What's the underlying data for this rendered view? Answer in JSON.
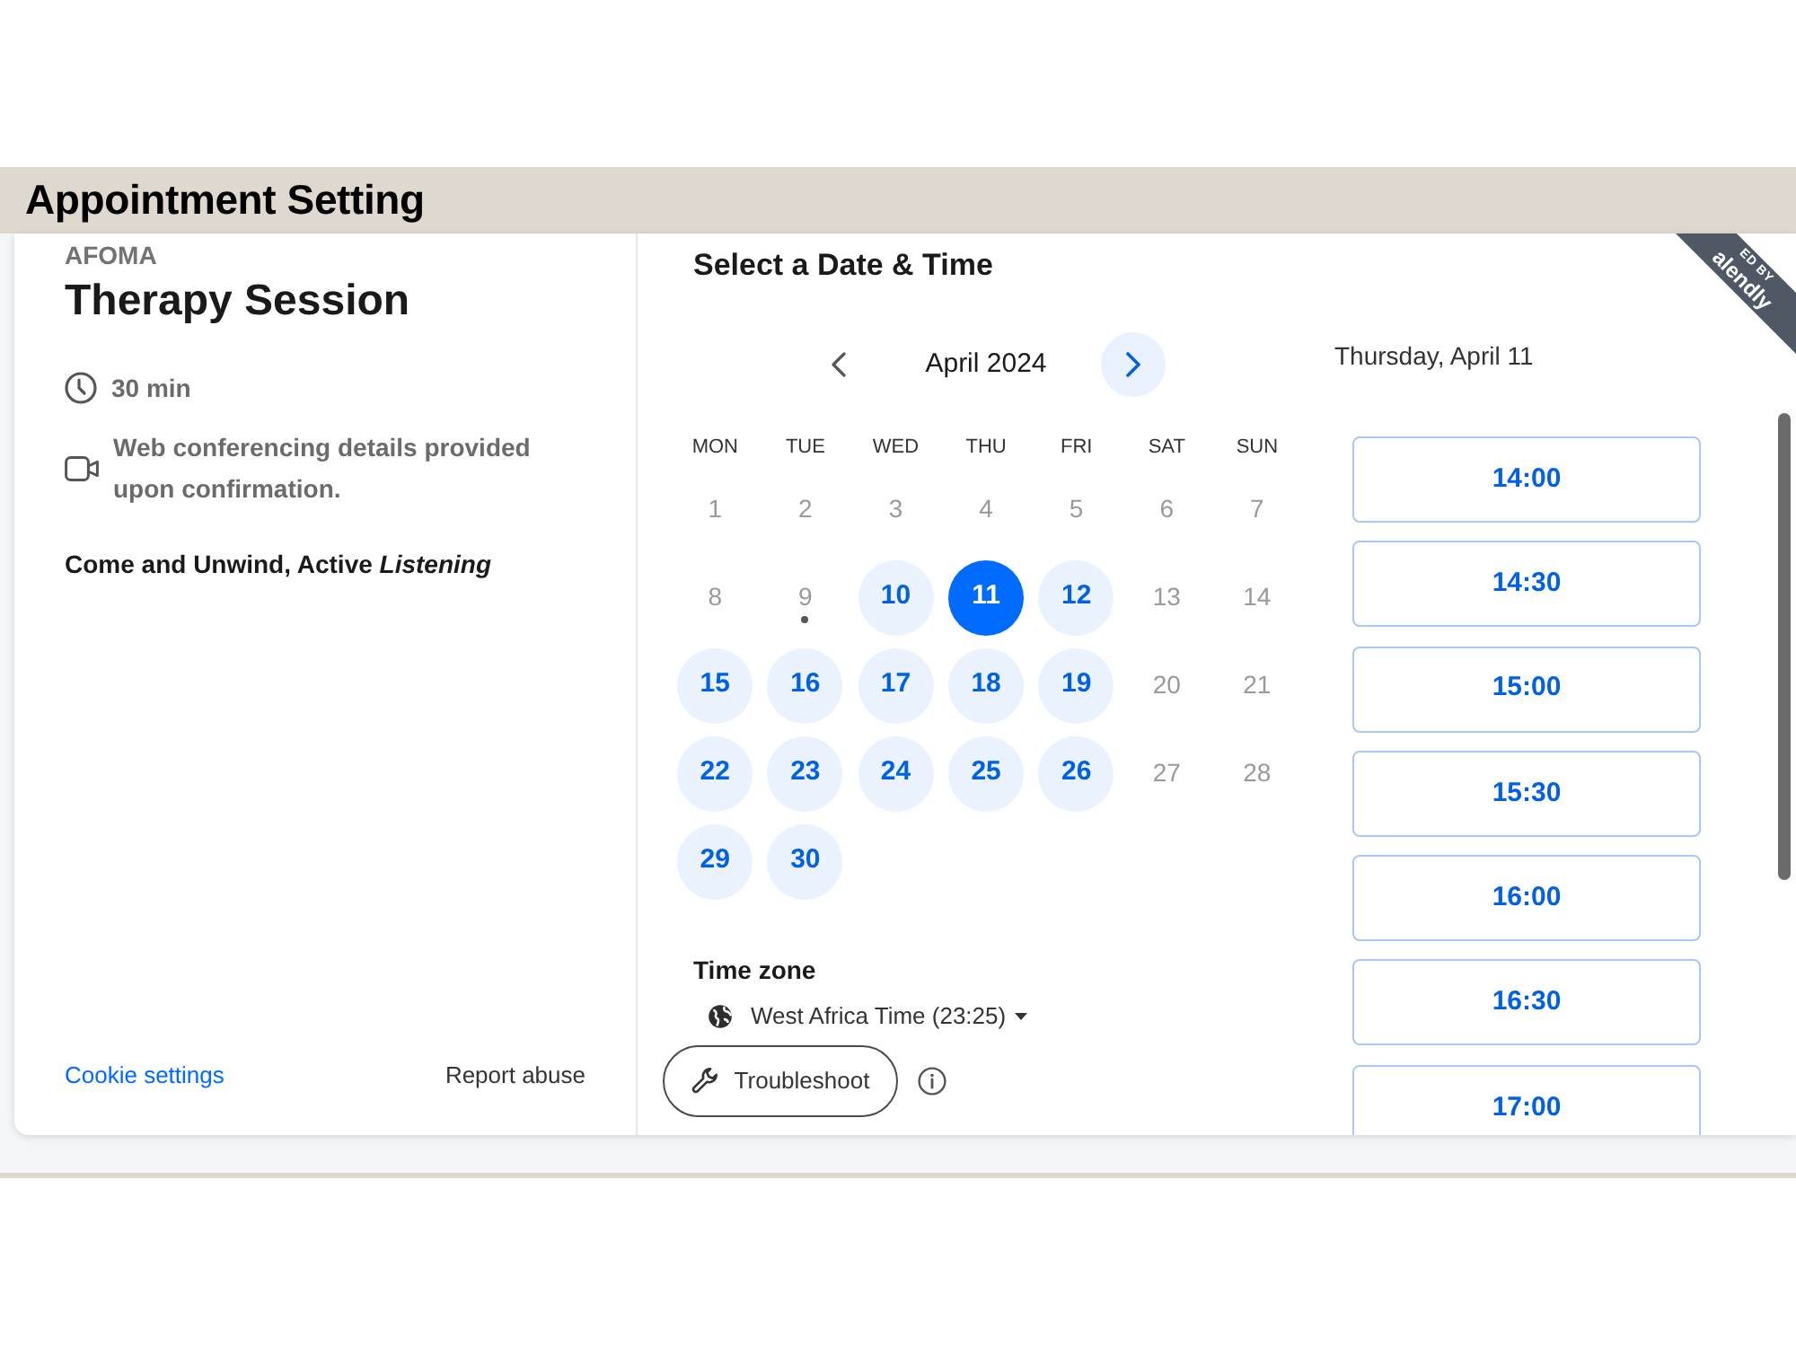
{
  "header": {
    "title": "Appointment Setting"
  },
  "event": {
    "organizer": "AFOMA",
    "title": "Therapy Session",
    "details": [
      {
        "kind": "duration",
        "text": "30 min"
      },
      {
        "kind": "video",
        "text": "Web conferencing details provided upon confirmation."
      }
    ],
    "description": "Come and Unwind, Active *Listening*"
  },
  "footer_links": [
    {
      "label": "Cookie settings",
      "kind": "link"
    },
    {
      "label": "Report abuse",
      "kind": "plain"
    }
  ],
  "calendar": {
    "heading": "Select a Date & Time",
    "month": "April 2024",
    "prev": {
      "disabled": true
    },
    "next": {
      "disabled": false
    },
    "weekdays": [
      "MON",
      "TUE",
      "WED",
      "THU",
      "FRI",
      "SAT",
      "SUN"
    ],
    "days": [
      {
        "label": "1",
        "available": false,
        "selected": false,
        "today": false
      },
      {
        "label": "2",
        "available": false,
        "selected": false,
        "today": false
      },
      {
        "label": "3",
        "available": false,
        "selected": false,
        "today": false
      },
      {
        "label": "4",
        "available": false,
        "selected": false,
        "today": false
      },
      {
        "label": "5",
        "available": false,
        "selected": false,
        "today": false
      },
      {
        "label": "6",
        "available": false,
        "selected": false,
        "today": false
      },
      {
        "label": "7",
        "available": false,
        "selected": false,
        "today": false
      },
      {
        "label": "8",
        "available": false,
        "selected": false,
        "today": false
      },
      {
        "label": "9",
        "available": false,
        "selected": false,
        "today": true
      },
      {
        "label": "10",
        "available": true,
        "selected": false,
        "today": false
      },
      {
        "label": "11",
        "available": true,
        "selected": true,
        "today": false
      },
      {
        "label": "12",
        "available": true,
        "selected": false,
        "today": false
      },
      {
        "label": "13",
        "available": false,
        "selected": false,
        "today": false
      },
      {
        "label": "14",
        "available": false,
        "selected": false,
        "today": false
      },
      {
        "label": "15",
        "available": true,
        "selected": false,
        "today": false
      },
      {
        "label": "16",
        "available": true,
        "selected": false,
        "today": false
      },
      {
        "label": "17",
        "available": true,
        "selected": false,
        "today": false
      },
      {
        "label": "18",
        "available": true,
        "selected": false,
        "today": false
      },
      {
        "label": "19",
        "available": true,
        "selected": false,
        "today": false
      },
      {
        "label": "20",
        "available": false,
        "selected": false,
        "today": false
      },
      {
        "label": "21",
        "available": false,
        "selected": false,
        "today": false
      },
      {
        "label": "22",
        "available": true,
        "selected": false,
        "today": false
      },
      {
        "label": "23",
        "available": true,
        "selected": false,
        "today": false
      },
      {
        "label": "24",
        "available": true,
        "selected": false,
        "today": false
      },
      {
        "label": "25",
        "available": true,
        "selected": false,
        "today": false
      },
      {
        "label": "26",
        "available": true,
        "selected": false,
        "today": false
      },
      {
        "label": "27",
        "available": false,
        "selected": false,
        "today": false
      },
      {
        "label": "28",
        "available": false,
        "selected": false,
        "today": false
      },
      {
        "label": "29",
        "available": true,
        "selected": false,
        "today": false
      },
      {
        "label": "30",
        "available": true,
        "selected": false,
        "today": false
      }
    ]
  },
  "timezone": {
    "label": "Time zone",
    "value": "West Africa Time (23:25)"
  },
  "troubleshoot": {
    "label": "Troubleshoot"
  },
  "slots": {
    "date": "Thursday, April 11",
    "times": [
      {
        "label": "14:00",
        "selected": false
      },
      {
        "label": "14:30",
        "selected": false
      },
      {
        "label": "15:00",
        "selected": false
      },
      {
        "label": "15:30",
        "selected": false
      },
      {
        "label": "16:00",
        "selected": false
      },
      {
        "label": "16:30",
        "selected": false
      },
      {
        "label": "17:00",
        "selected": false
      }
    ]
  },
  "ribbon": {
    "lines": [
      "ED BY",
      "alendly"
    ]
  }
}
